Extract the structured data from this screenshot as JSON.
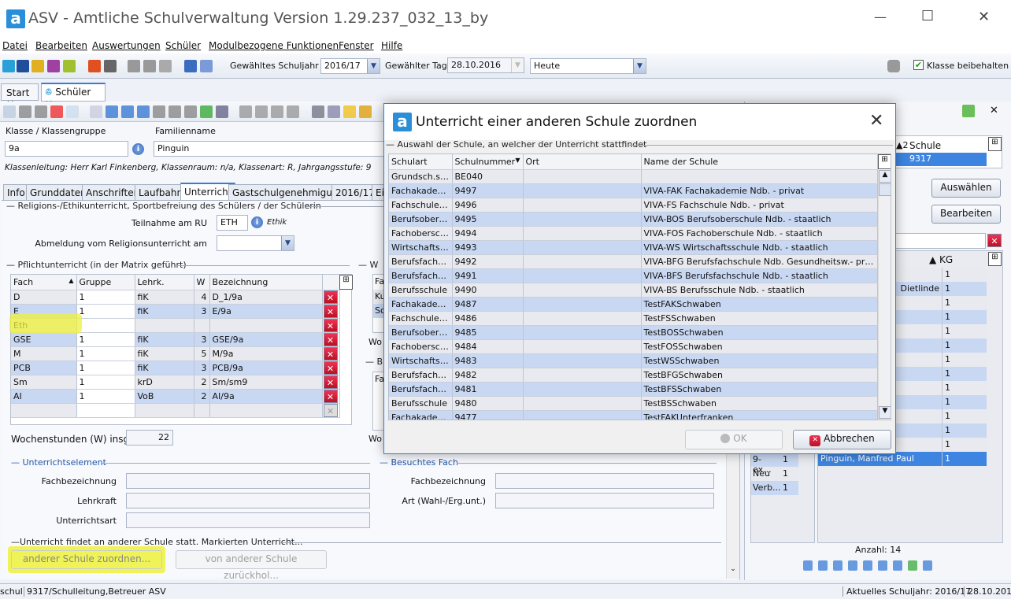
{
  "window": {
    "title": "ASV - Amtliche Schulverwaltung Version 1.29.237_032_13_by",
    "minimize": "—",
    "maximize": "☐",
    "close": "✕",
    "logo": "a"
  },
  "menu": [
    "Datei",
    "Bearbeiten",
    "Auswertungen",
    "Schüler",
    "Modulbezogene Funktionen",
    "Fenster",
    "Hilfe"
  ],
  "toolbar": {
    "schuljahr_label": "Gewähltes Schuljahr",
    "schuljahr": "2016/17",
    "tag_label": "Gewählter Tag",
    "tag": "28.10.2016",
    "tag_mode": "Heute",
    "klasse_beibehalten": "Klasse beibehalten",
    "klasse_beibehalten_checked": true
  },
  "tabs": [
    {
      "label": "Start"
    },
    {
      "label": "Schüler"
    }
  ],
  "student": {
    "klasse_label": "Klasse / Klassengruppe",
    "klasse": "9a",
    "familienname_label": "Familienname",
    "familienname": "Pinguin",
    "klassenleitung": "Klassenleitung: Herr Karl Finkenberg, Klassenraum: n/a, Klassenart: R, Jahrgangsstufe: 9"
  },
  "subtabs": [
    "Info",
    "Grunddaten",
    "Anschriften",
    "Laufbahn",
    "Unterricht",
    "Gastschulgenehmigung",
    "2016/17",
    "Ei"
  ],
  "religion": {
    "group": "Religions-/Ethikunterricht, Sportbefreiung des Schülers / der Schülerin",
    "teilnahme_label": "Teilnahme am RU",
    "teilnahme": "ETH",
    "teilnahme_hint": "Ethik",
    "abmeldung_label": "Abmeldung vom Religionsunterricht am",
    "abmeldung": ""
  },
  "pflicht": {
    "group": "Pflichtunterricht (in der Matrix geführt)",
    "columns": [
      "Fach",
      "Gruppe",
      "Lehrk.",
      "W",
      "Bezeichnung"
    ],
    "rows": [
      [
        "D",
        "1",
        "fiK",
        "4",
        "D_1/9a"
      ],
      [
        "E",
        "1",
        "fiK",
        "3",
        "E/9a"
      ],
      [
        "Eth",
        "",
        "",
        "",
        ""
      ],
      [
        "GSE",
        "1",
        "fiK",
        "3",
        "GSE/9a"
      ],
      [
        "M",
        "1",
        "fiK",
        "5",
        "M/9a"
      ],
      [
        "PCB",
        "1",
        "fiK",
        "3",
        "PCB/9a"
      ],
      [
        "Sm",
        "1",
        "krD",
        "2",
        "Sm/sm9"
      ],
      [
        "AI",
        "1",
        "VoB",
        "2",
        "AI/9a"
      ],
      [
        "",
        "",
        "",
        "",
        ""
      ]
    ],
    "wochenstunden_label": "Wochenstunden (W) insg.",
    "wochenstunden": "22"
  },
  "side_partial": {
    "w_group": "W",
    "w_rows": [
      "Fa",
      "Ku",
      "So"
    ],
    "wo1": "Wo",
    "b_group": "B",
    "b_rows": [
      "Fa"
    ],
    "wo2": "Wo"
  },
  "unterrichtselement": {
    "group": "Unterrichtselement",
    "fach_label": "Fachbezeichnung",
    "lehrkraft_label": "Lehrkraft",
    "art_label": "Unterrichtsart"
  },
  "besuchtes_fach": {
    "group": "Besuchtes Fach",
    "fach_label": "Fachbezeichnung",
    "art_label": "Art (Wahl-/Erg.unt.)"
  },
  "andere_schule": {
    "group": "Unterricht findet an anderer Schule statt. Markierten Unterricht...",
    "zuordnen": "anderer Schule zuordnen...",
    "zurueck": "von anderer Schule zurückhol..."
  },
  "right_panel": {
    "col_sort": "2",
    "col_schule": "Schule",
    "schule": "9317",
    "auswaehlen": "Auswählen",
    "bearbeiten": "Bearbeiten",
    "kg_col": "KG",
    "students": [
      {
        "name": "",
        "kg": "1"
      },
      {
        "name": "Dietlinde",
        "kg": "1"
      },
      {
        "name": "",
        "kg": "1"
      },
      {
        "name": "",
        "kg": "1"
      },
      {
        "name": "",
        "kg": "1"
      },
      {
        "name": "",
        "kg": "1"
      },
      {
        "name": "",
        "kg": "1"
      },
      {
        "name": "",
        "kg": "1"
      },
      {
        "name": "",
        "kg": "1"
      },
      {
        "name": "",
        "kg": "1"
      },
      {
        "name": "",
        "kg": "1"
      },
      {
        "name": "",
        "kg": "1"
      },
      {
        "name": "",
        "kg": "1"
      },
      {
        "name": "Pinguin, Manfred Paul",
        "kg": "1",
        "selected": true
      }
    ],
    "groups": [
      [
        "9-ex...",
        "1"
      ],
      [
        "Neu",
        "1"
      ],
      [
        "Verb...",
        "1"
      ]
    ],
    "anzahl": "Anzahl: 14"
  },
  "statusbar": {
    "left": "schul",
    "user": "9317/Schulleitung,Betreuer ASV",
    "schuljahr": "Aktuelles Schuljahr: 2016/17",
    "datum": "28.10.2016"
  },
  "dialog": {
    "title": "Unterricht einer anderen Schule zuordnen",
    "group": "Auswahl der Schule, an welcher der Unterricht stattfindet",
    "columns": [
      "Schulart",
      "Schulnummer",
      "Ort",
      "Name der Schule"
    ],
    "rows": [
      [
        "Grundsch.so...",
        "BE040",
        "",
        ""
      ],
      [
        "Fachakademi...",
        "9497",
        "",
        "VIVA-FAK Fachakademie Ndb. - privat"
      ],
      [
        "Fachschule S...",
        "9496",
        "",
        "VIVA-FS Fachschule Ndb. - privat"
      ],
      [
        "Berufsobersc...",
        "9495",
        "",
        "VIVA-BOS Berufsoberschule Ndb. - staatlich"
      ],
      [
        "Fachobersch...",
        "9494",
        "",
        "VIVA-FOS Fachoberschule Ndb. - staatlich"
      ],
      [
        "Wirtschaftssc...",
        "9493",
        "",
        "VIVA-WS Wirtschaftsschule Ndb. - staatlich"
      ],
      [
        "Berufsfachsc...",
        "9492",
        "",
        "VIVA-BFG Berufsfachschule Ndb. Gesundheitsw.- privat"
      ],
      [
        "Berufsfachsc...",
        "9491",
        "",
        "VIVA-BFS Berufsfachschule Ndb. - staatlich"
      ],
      [
        "Berufsschule",
        "9490",
        "",
        "VIVA-BS Berufsschule Ndb. - staatlich"
      ],
      [
        "Fachakademi...",
        "9487",
        "",
        "TestFAKSchwaben"
      ],
      [
        "Fachschule S...",
        "9486",
        "",
        "TestFSSchwaben"
      ],
      [
        "Berufsobersc...",
        "9485",
        "",
        "TestBOSSchwaben"
      ],
      [
        "Fachobersch...",
        "9484",
        "",
        "TestFOSSchwaben"
      ],
      [
        "Wirtschaftssc...",
        "9483",
        "",
        "TestWSSchwaben"
      ],
      [
        "Berufsfachsc...",
        "9482",
        "",
        "TestBFGSchwaben"
      ],
      [
        "Berufsfachsc...",
        "9481",
        "",
        "TestBFSSchwaben"
      ],
      [
        "Berufsschule",
        "9480",
        "",
        "TestBSSchwaben"
      ],
      [
        "Fachakademi...",
        "9477",
        "",
        "TestFAKUnterfranken"
      ]
    ],
    "ok": "OK",
    "cancel": "Abbrechen"
  },
  "colors": {
    "accent": "#3a7bd5",
    "row_blue": "#c9d8f2",
    "row_gray": "#e9eaef",
    "highlight": "#eef23a",
    "selected": "#3d85e0"
  }
}
